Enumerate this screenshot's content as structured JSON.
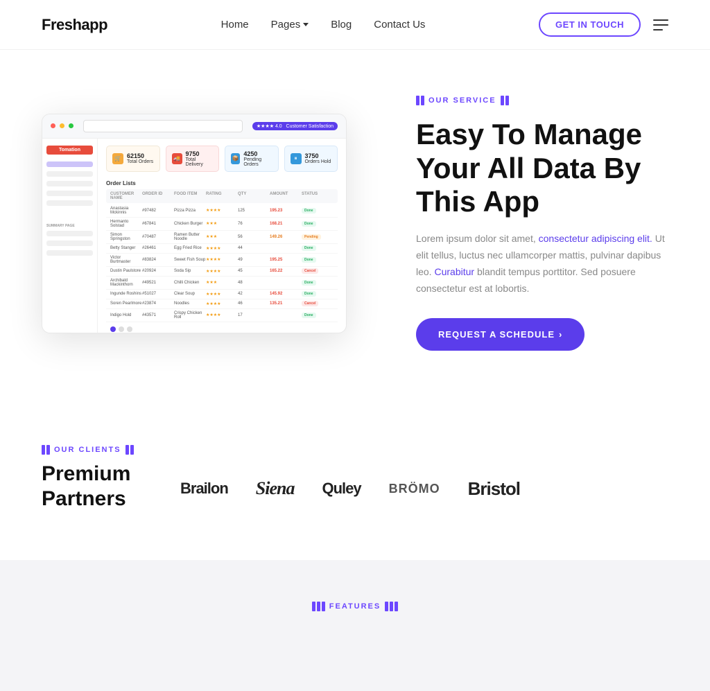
{
  "brand": {
    "logo": "Freshapp"
  },
  "navbar": {
    "links": [
      {
        "label": "Home",
        "id": "home"
      },
      {
        "label": "Pages",
        "id": "pages",
        "hasDropdown": true
      },
      {
        "label": "Blog",
        "id": "blog"
      },
      {
        "label": "Contact Us",
        "id": "contact"
      }
    ],
    "cta": "GET IN TOUCH"
  },
  "hero": {
    "service_label": "OUR SERVICE",
    "title": "Easy To Manage Your All Data By This App",
    "description_part1": "Lorem ipsum dolor sit amet, consectetur adipiscing elit. Ut elit tellus, luctus nec ullamcorper mattis, pulvinar dapibus leo. Curabitur blandit tempus porttitor. Sed posuere consectetur est at lobortis.",
    "cta_button": "REQUEST A SCHEDULE",
    "cta_arrow": "›"
  },
  "dashboard": {
    "stats": [
      {
        "number": "62150",
        "label": "Total Orders",
        "color": "#f4a93c"
      },
      {
        "number": "9750",
        "label": "Total Delivery",
        "color": "#e74c3c"
      },
      {
        "number": "4250",
        "label": "Pending Orders",
        "color": "#3498db"
      },
      {
        "number": "3750",
        "label": "Orders Hold",
        "color": "#3498db"
      }
    ],
    "user_badge": "Customer Satisfaction ★★★★ 4.0",
    "table": {
      "columns": [
        "Name",
        "ID",
        "Food Item",
        "Rating",
        "Qty",
        "Amount",
        "Status"
      ],
      "rows": [
        {
          "name": "Anastasia Mckinnis",
          "id": "#97482",
          "item": "Pizza Pizza",
          "stars": 4,
          "qty": "125",
          "amount": "195.23",
          "status": "green"
        },
        {
          "name": "Hermanto Solstad",
          "id": "#67841",
          "item": "Chicken Burger",
          "stars": 3,
          "qty": "76",
          "amount": "168.21",
          "status": "green"
        },
        {
          "name": "Simon Springston",
          "id": "#70487",
          "item": "Ramen Butter Noodle",
          "stars": 3,
          "qty": "56",
          "amount": "149.26",
          "status": "orange"
        },
        {
          "name": "Betty Stanger",
          "id": "#26461",
          "item": "Egg Fried Rice",
          "stars": 4,
          "qty": "44",
          "amount": "",
          "status": "green"
        },
        {
          "name": "Victor Burtmaster",
          "id": "#83824",
          "item": "Sweet Fish Soup",
          "stars": 4,
          "qty": "49",
          "amount": "195.25",
          "status": "green"
        },
        {
          "name": "Dustin Paulstore",
          "id": "#20924",
          "item": "Soda Sip",
          "stars": 4,
          "qty": "45",
          "amount": "165.22",
          "status": "red"
        },
        {
          "name": "Archibald Mackinthorn",
          "id": "#49521",
          "item": "Chilli Chicken",
          "stars": 3,
          "qty": "48",
          "amount": "",
          "status": "green"
        },
        {
          "name": "Ingunde Roshins",
          "id": "#51027",
          "item": "Clear Soup",
          "stars": 4,
          "qty": "42",
          "amount": "145.92",
          "status": "green"
        },
        {
          "name": "Soren Pearlmore",
          "id": "#23874",
          "item": "Noodles",
          "stars": 4,
          "qty": "46",
          "amount": "135.21",
          "status": "red"
        },
        {
          "name": "Indigo Hold",
          "id": "#43571",
          "item": "Crispy Chicken Roll",
          "stars": 4,
          "qty": "17",
          "amount": "",
          "status": "green"
        }
      ]
    }
  },
  "clients": {
    "section_label": "OUR CLIENTS",
    "title": "Premium Partners",
    "logos": [
      {
        "name": "Brailon",
        "style": "normal"
      },
      {
        "name": "Siena",
        "style": "siena"
      },
      {
        "name": "Quley",
        "style": "normal"
      },
      {
        "name": "BRÖMO",
        "style": "bromo"
      },
      {
        "name": "Bristol",
        "style": "bristol"
      }
    ]
  },
  "features": {
    "section_label": "FEATURES"
  }
}
